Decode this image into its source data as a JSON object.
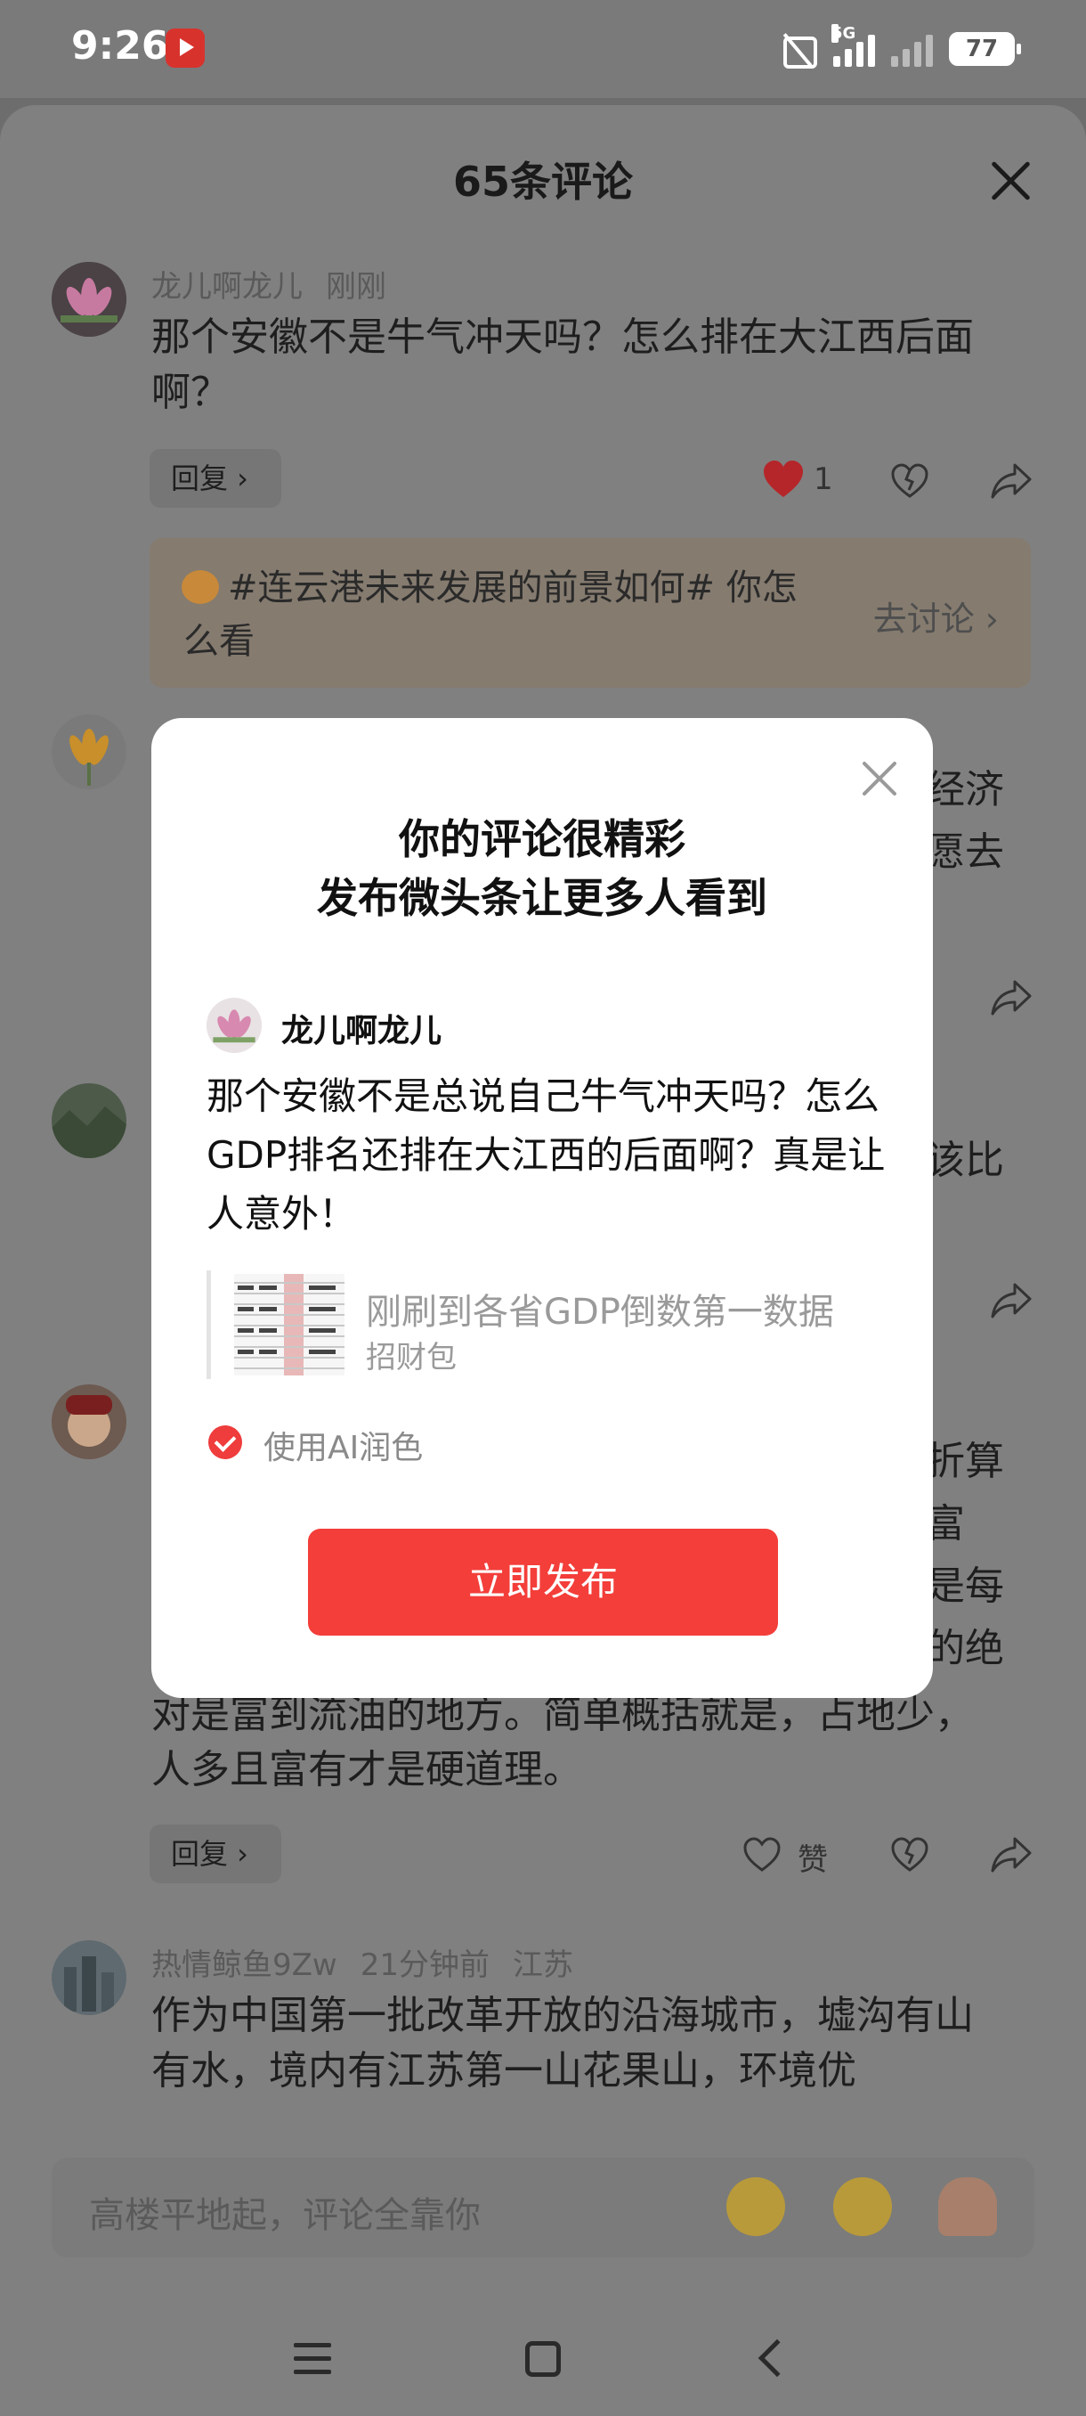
{
  "status_bar": {
    "time": "9:26",
    "network": "5G",
    "battery": "77"
  },
  "sheet": {
    "title": "65条评论"
  },
  "comments": [
    {
      "author": "龙儿啊龙儿",
      "time": "刚刚",
      "text": "那个安徽不是牛气冲天吗？怎么排在大江西后面啊？",
      "reply_label": "回复 ›",
      "like_count": "1"
    }
  ],
  "topic": {
    "text": "#连云港未来发展的前景如何# 你怎么看",
    "cta": "去讨论 ›"
  },
  "partial_comments": {
    "c2_right_line1": "经济",
    "c2_right_line2": "愿去",
    "c3_right_line1": "该比",
    "c4_right_line1": "折算",
    "c4_right_line2": "富",
    "c4_right_line3": "是每",
    "c4_right_line4": "的绝",
    "c4_visible_text": "对是富到流油的地方。简单概括就是，占地少，人多且富有才是硬道理。",
    "c4_reply_label": "回复 ›",
    "c4_like_label": "赞"
  },
  "comment5": {
    "author": "热情鲸鱼9Zw",
    "time": "21分钟前",
    "location": "江苏",
    "text": "作为中国第一批改革开放的沿海城市，墟沟有山有水，境内有江苏第一山花果山，环境优"
  },
  "composer": {
    "placeholder": "高楼平地起，评论全靠你"
  },
  "modal": {
    "title_line1": "你的评论很精彩",
    "title_line2": "发布微头条让更多人看到",
    "user_name": "龙儿啊龙儿",
    "post_text": "那个安徽不是总说自己牛气冲天吗？怎么GDP排名还排在大江西的后面啊？真是让人意外！",
    "quote_title": "刚刷到各省GDP倒数第一数据",
    "quote_source": "招财包",
    "ai_label": "使用AI润色",
    "publish_label": "立即发布"
  }
}
